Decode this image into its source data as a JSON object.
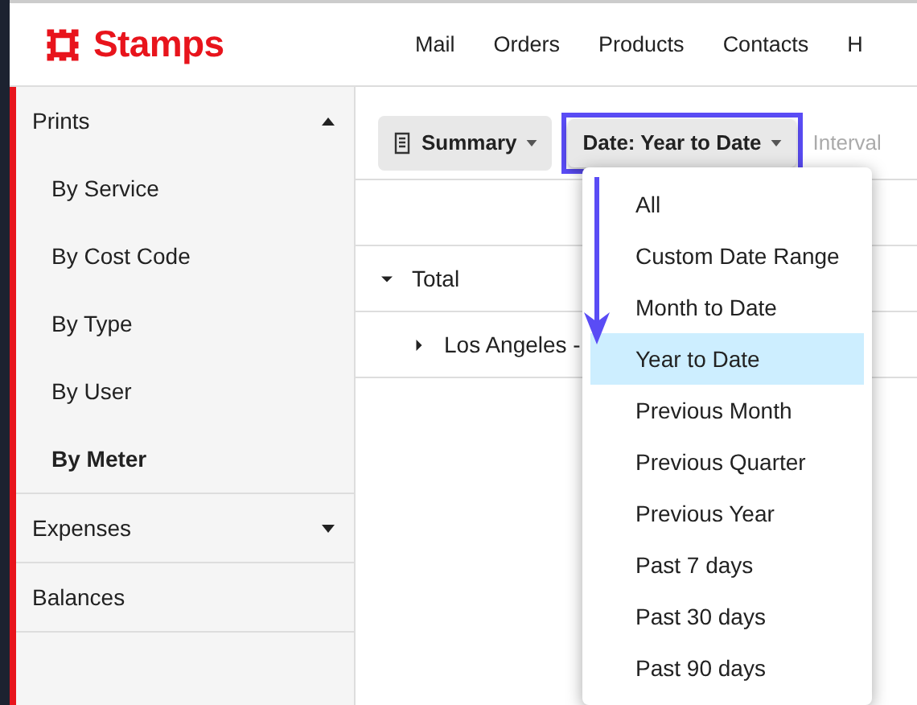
{
  "brand": {
    "name": "Stamps"
  },
  "nav": [
    {
      "label": "Mail"
    },
    {
      "label": "Orders"
    },
    {
      "label": "Products"
    },
    {
      "label": "Contacts"
    },
    {
      "label": "H"
    }
  ],
  "sidebar": {
    "sections": [
      {
        "label": "Prints",
        "expanded": true,
        "children": [
          {
            "label": "By Service",
            "selected": false
          },
          {
            "label": "By Cost Code",
            "selected": false
          },
          {
            "label": "By Type",
            "selected": false
          },
          {
            "label": "By User",
            "selected": false
          },
          {
            "label": "By Meter",
            "selected": true
          }
        ]
      },
      {
        "label": "Expenses",
        "expanded": false
      },
      {
        "label": "Balances"
      }
    ]
  },
  "toolbar": {
    "summary": "Summary",
    "date": "Date: Year to Date",
    "interval": "Interval"
  },
  "table": {
    "rows": [
      {
        "label": "Total",
        "expanded": true,
        "children": [
          {
            "label": "Los Angeles -",
            "expanded": false
          }
        ]
      }
    ]
  },
  "date_menu": [
    {
      "label": "All",
      "selected": false
    },
    {
      "label": "Custom Date Range",
      "selected": false
    },
    {
      "label": "Month to Date",
      "selected": false
    },
    {
      "label": "Year to Date",
      "selected": true
    },
    {
      "label": "Previous Month",
      "selected": false
    },
    {
      "label": "Previous Quarter",
      "selected": false
    },
    {
      "label": "Previous Year",
      "selected": false
    },
    {
      "label": "Past 7 days",
      "selected": false
    },
    {
      "label": "Past 30 days",
      "selected": false
    },
    {
      "label": "Past 90 days",
      "selected": false
    }
  ]
}
